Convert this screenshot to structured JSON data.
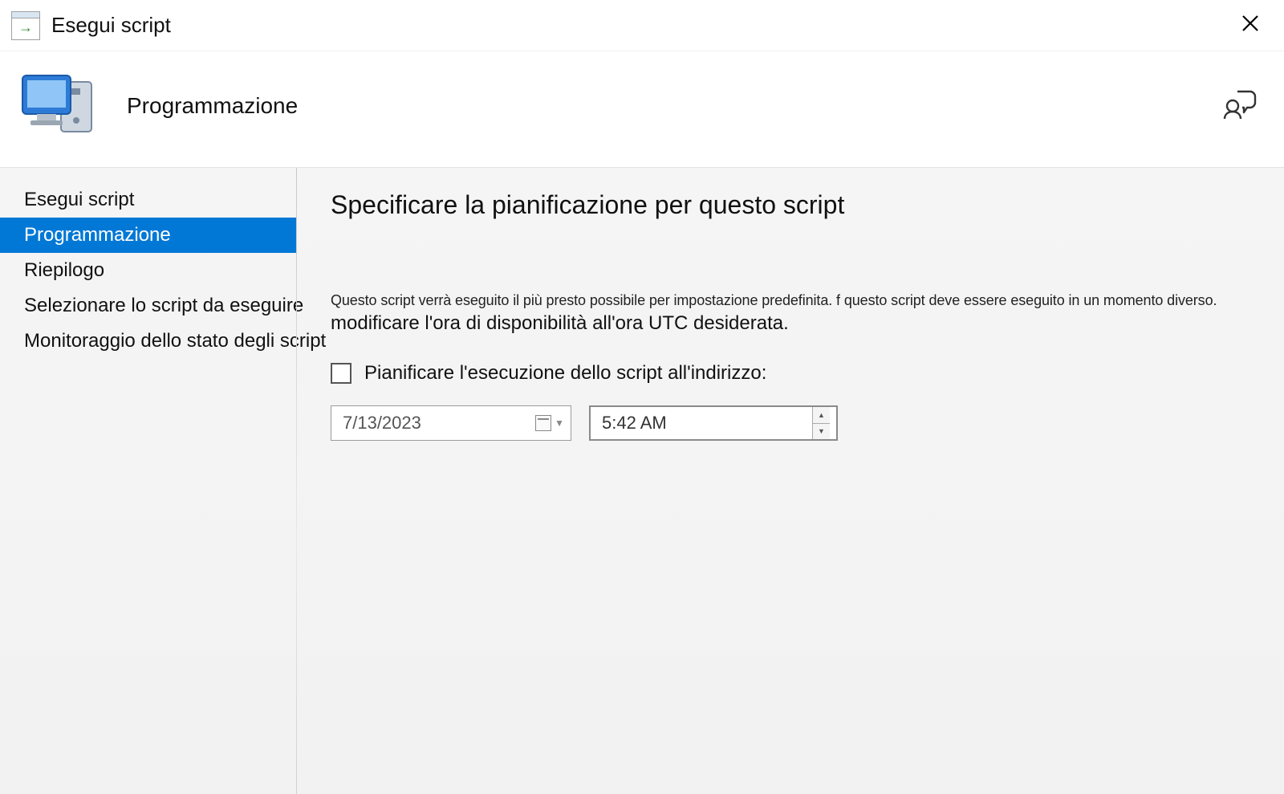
{
  "window": {
    "title": "Esegui script"
  },
  "header": {
    "page_title": "Programmazione"
  },
  "sidebar": {
    "items": [
      {
        "label": "Esegui script",
        "selected": false
      },
      {
        "label": "Programmazione",
        "selected": true
      },
      {
        "label": "Riepilogo",
        "selected": false
      },
      {
        "label": "Selezionare lo script da eseguire",
        "selected": false
      },
      {
        "label": "Monitoraggio dello stato degli script",
        "selected": false
      }
    ]
  },
  "content": {
    "heading": "Specificare la pianificazione per questo script",
    "desc_line1": "Questo script verrà eseguito il più presto possibile per impostazione predefinita. f questo script deve essere eseguito in un momento diverso.",
    "desc_line2": "modificare l'ora di disponibilità all'ora UTC desiderata.",
    "checkbox_label": "Pianificare l'esecuzione dello script all'indirizzo:",
    "date_value": "7/13/2023",
    "time_value": "5:42 AM"
  }
}
